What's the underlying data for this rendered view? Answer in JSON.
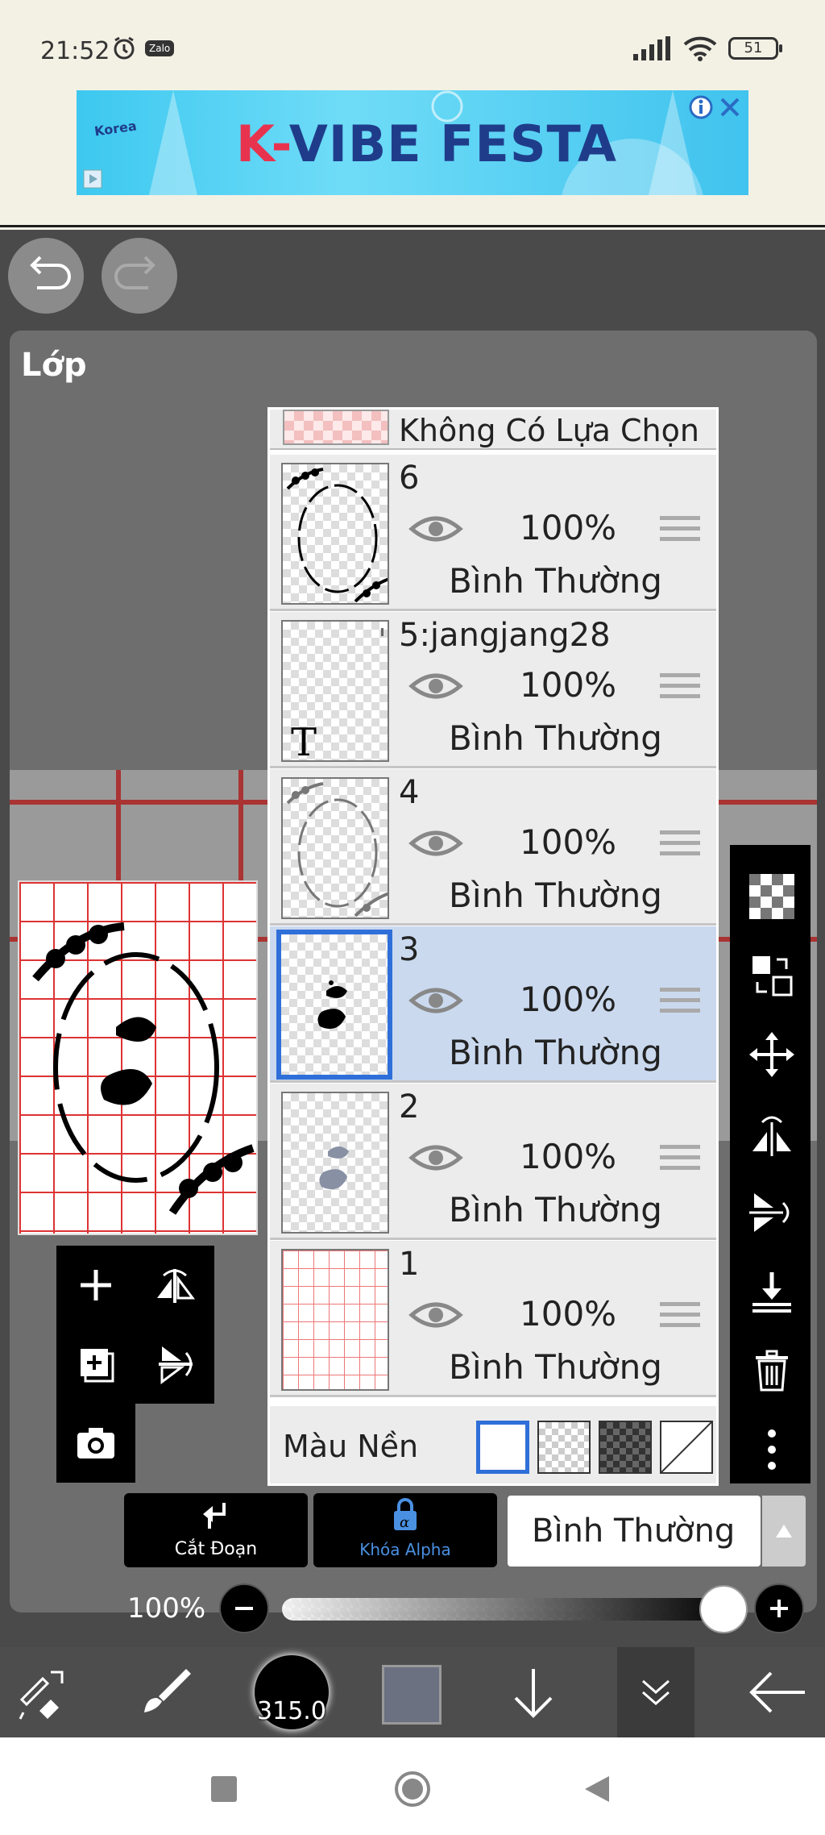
{
  "status_bar": {
    "time": "21:52",
    "notification_app": "Zalo",
    "battery_level": "51"
  },
  "ad": {
    "brand": "Korea",
    "title_accent": "K-",
    "title_rest": "VIBE FESTA"
  },
  "layers_panel": {
    "title": "Lớp",
    "no_selection_label": "Không Có Lựa Chọn",
    "layers": [
      {
        "name": "6",
        "opacity": "100%",
        "blend": "Bình Thường",
        "selected": false
      },
      {
        "name": "5:jangjang28",
        "opacity": "100%",
        "blend": "Bình Thường",
        "selected": false
      },
      {
        "name": "4",
        "opacity": "100%",
        "blend": "Bình Thường",
        "selected": false
      },
      {
        "name": "3",
        "opacity": "100%",
        "blend": "Bình Thường",
        "selected": true
      },
      {
        "name": "2",
        "opacity": "100%",
        "blend": "Bình Thường",
        "selected": false
      },
      {
        "name": "1",
        "opacity": "100%",
        "blend": "Bình Thường",
        "selected": false
      }
    ],
    "background_label": "Màu Nền"
  },
  "actions": {
    "clipping_label": "Cắt Đoạn",
    "alpha_lock_label": "Khóa Alpha",
    "blend_mode_value": "Bình Thường"
  },
  "opacity": {
    "label": "100%",
    "value_fraction": 1.0
  },
  "bottom_toolbar": {
    "brush_size": "315.0",
    "current_color": "#6b7180"
  },
  "colors": {
    "accent_blue": "#2f6fd9",
    "selected_row": "#cad9ee",
    "grid_red": "#d33"
  }
}
